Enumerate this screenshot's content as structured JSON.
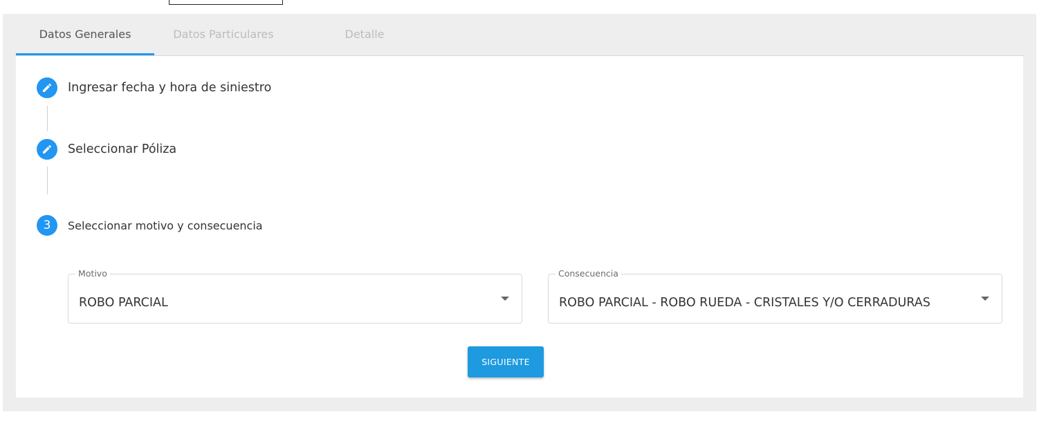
{
  "tabs": [
    {
      "label": "Datos Generales",
      "active": true
    },
    {
      "label": "Datos Particulares",
      "active": false
    },
    {
      "label": "Detalle",
      "active": false
    }
  ],
  "steps": [
    {
      "icon": "pencil-icon",
      "label": "Ingresar fecha y hora de siniestro",
      "status": "completed"
    },
    {
      "icon": "pencil-icon",
      "label": "Seleccionar Póliza",
      "status": "completed"
    },
    {
      "number": "3",
      "label": "Seleccionar motivo y consecuencia",
      "status": "active"
    }
  ],
  "form": {
    "motivo": {
      "label": "Motivo",
      "value": "ROBO PARCIAL"
    },
    "consecuencia": {
      "label": "Consecuencia",
      "value": "ROBO PARCIAL - ROBO RUEDA - CRISTALES Y/O CERRADURAS"
    }
  },
  "actions": {
    "next_label": "SIGUIENTE"
  },
  "colors": {
    "accent": "#2196f3",
    "button": "#1e9ae0",
    "background": "#eeeeee"
  }
}
